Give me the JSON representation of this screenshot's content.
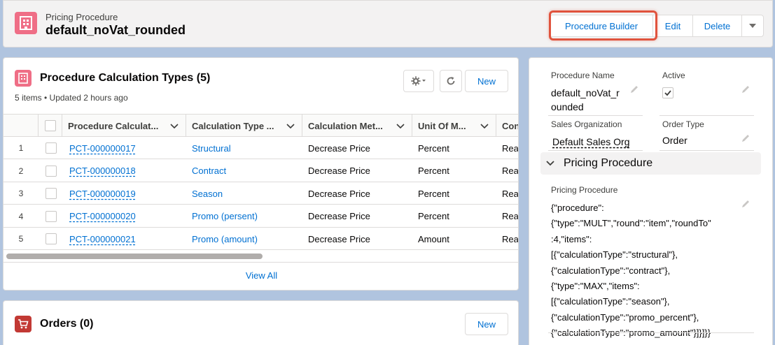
{
  "header": {
    "object_label": "Pricing Procedure",
    "record_name": "default_noVat_rounded",
    "buttons": {
      "procedure_builder": "Procedure Builder",
      "edit": "Edit",
      "delete": "Delete"
    }
  },
  "related_calc_types": {
    "title": "Procedure Calculation Types (5)",
    "subtitle": "5 items • Updated 2 hours ago",
    "new_label": "New",
    "columns": [
      "Procedure Calculat...",
      "Calculation Type ...",
      "Calculation Met...",
      "Unit Of M...",
      "Con"
    ],
    "rows": [
      {
        "num": "1",
        "name": "PCT-000000017",
        "type": "Structural",
        "method": "Decrease Price",
        "unit": "Percent",
        "con": "Rea"
      },
      {
        "num": "2",
        "name": "PCT-000000018",
        "type": "Contract",
        "method": "Decrease Price",
        "unit": "Percent",
        "con": "Rea"
      },
      {
        "num": "3",
        "name": "PCT-000000019",
        "type": "Season",
        "method": "Decrease Price",
        "unit": "Percent",
        "con": "Rea"
      },
      {
        "num": "4",
        "name": "PCT-000000020",
        "type": "Promo (persent)",
        "method": "Decrease Price",
        "unit": "Percent",
        "con": "Rea"
      },
      {
        "num": "5",
        "name": "PCT-000000021",
        "type": "Promo (amount)",
        "method": "Decrease Price",
        "unit": "Amount",
        "con": "Rea"
      }
    ],
    "view_all": "View All"
  },
  "related_orders": {
    "title": "Orders (0)",
    "new_label": "New"
  },
  "details": {
    "procedure_name_label": "Procedure Name",
    "procedure_name_line1": "default_noVat_r",
    "procedure_name_line2": "ounded",
    "active_label": "Active",
    "active_checked": true,
    "sales_org_label": "Sales Organization",
    "sales_org_value": "Default Sales Org",
    "order_type_label": "Order Type",
    "order_type_value": "Order",
    "section_title": "Pricing Procedure",
    "pricing_procedure_label": "Pricing Procedure",
    "pricing_procedure_lines": [
      "{\"procedure\":",
      "{\"type\":\"MULT\",\"round\":\"item\",\"roundTo\"",
      ":4,\"items\":",
      "[{\"calculationType\":\"structural\"},",
      "{\"calculationType\":\"contract\"},",
      "{\"type\":\"MAX\",\"items\":",
      "[{\"calculationType\":\"season\"},",
      "{\"calculationType\":\"promo_percent\"},",
      "{\"calculationType\":\"promo_amount\"}]}]}}"
    ]
  },
  "colors": {
    "brand": "#0070d2",
    "header_icon": "#ef6e86",
    "orders_icon": "#c23934",
    "highlight": "#e0533d"
  }
}
